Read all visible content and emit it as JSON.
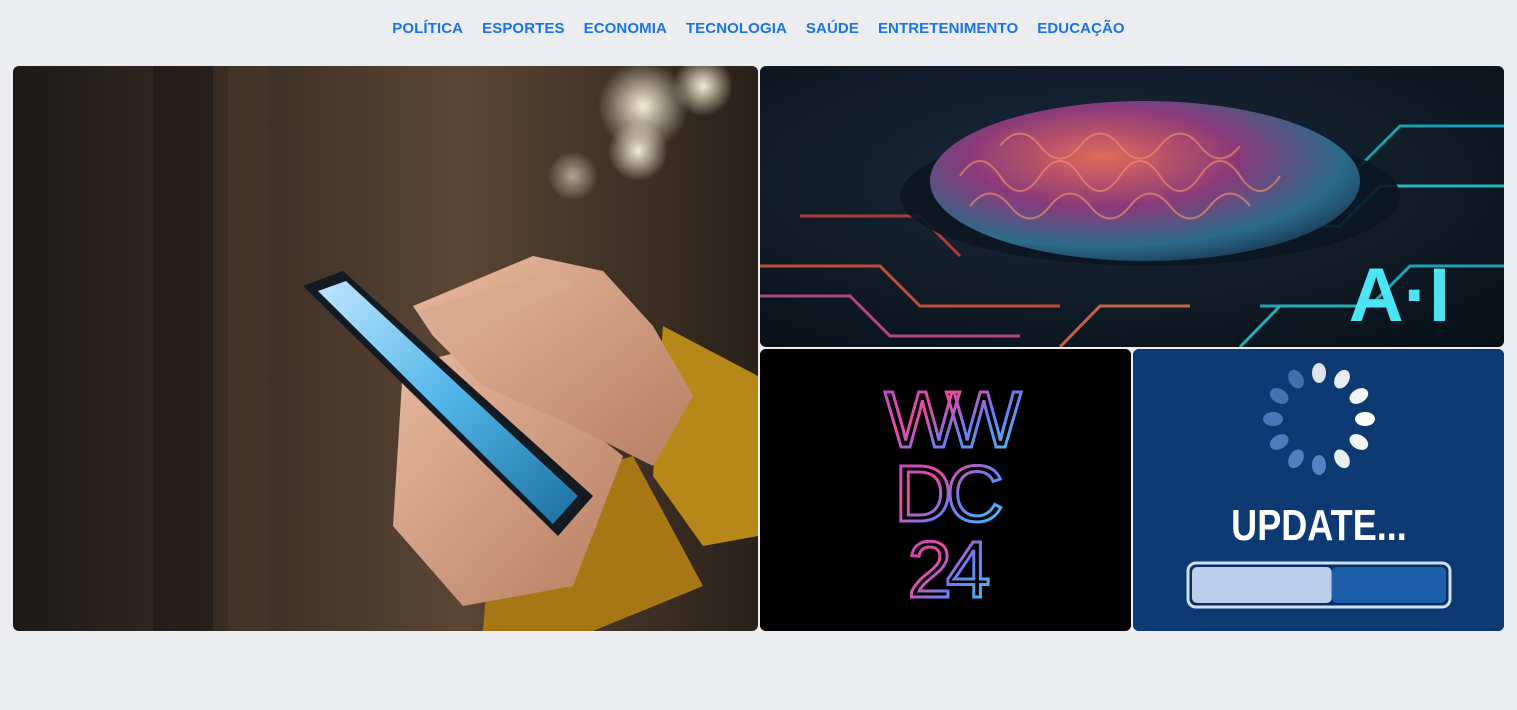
{
  "nav": {
    "items": [
      "POLÍTICA",
      "ESPORTES",
      "ECONOMIA",
      "TECNOLOGIA",
      "SAÚDE",
      "ENTRETENIMENTO",
      "EDUCAÇÃO"
    ]
  },
  "tiles": {
    "ai": {
      "overlay_text": "A·I"
    },
    "wwdc": {
      "line1": "WW",
      "line2": "DC",
      "line3": "24"
    },
    "update": {
      "label": "UPDATE...",
      "progress": 0.55
    }
  },
  "colors": {
    "nav_link": "#1a73e8",
    "page_bg": "#ecedf0",
    "update_bg": "#0d3a73"
  }
}
